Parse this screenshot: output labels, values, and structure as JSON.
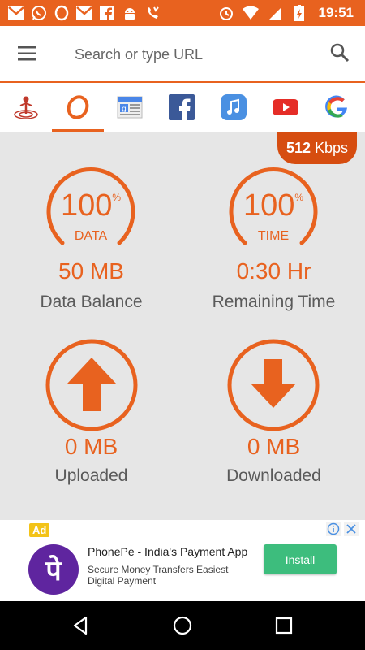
{
  "status_bar": {
    "time": "19:51",
    "left_icons": [
      "gmail-icon",
      "whatsapp-icon",
      "opera-icon",
      "gmail-icon",
      "facebook-icon",
      "android-icon",
      "missed-call-icon"
    ],
    "right_icons": [
      "alarm-icon",
      "wifi-icon",
      "signal-icon",
      "battery-charging-icon"
    ]
  },
  "search": {
    "placeholder": "Search or type URL"
  },
  "shortcuts": [
    {
      "name": "location-icon"
    },
    {
      "name": "opera-icon",
      "active": true
    },
    {
      "name": "news-icon"
    },
    {
      "name": "facebook-icon"
    },
    {
      "name": "music-icon"
    },
    {
      "name": "youtube-icon"
    },
    {
      "name": "google-icon"
    }
  ],
  "speed": {
    "value": "512",
    "unit": "Kbps"
  },
  "stats": {
    "data": {
      "percent": "100",
      "percent_sign": "%",
      "gauge_label": "DATA",
      "value": "50 MB",
      "caption": "Data Balance"
    },
    "time": {
      "percent": "100",
      "percent_sign": "%",
      "gauge_label": "TIME",
      "value": "0:30 Hr",
      "caption": "Remaining Time"
    },
    "uploaded": {
      "value": "0 MB",
      "caption": "Uploaded"
    },
    "downloaded": {
      "value": "0 MB",
      "caption": "Downloaded"
    }
  },
  "ad": {
    "badge": "Ad",
    "logo_text": "पे",
    "title": "PhonePe - India's Payment App",
    "description": "Secure Money Transfers Easiest Digital Payment",
    "cta": "Install"
  },
  "colors": {
    "accent": "#e8621f",
    "badge_dark": "#d64d10",
    "background": "#e6e6e6",
    "install": "#3dbd7d",
    "phonepe": "#5f259f"
  }
}
